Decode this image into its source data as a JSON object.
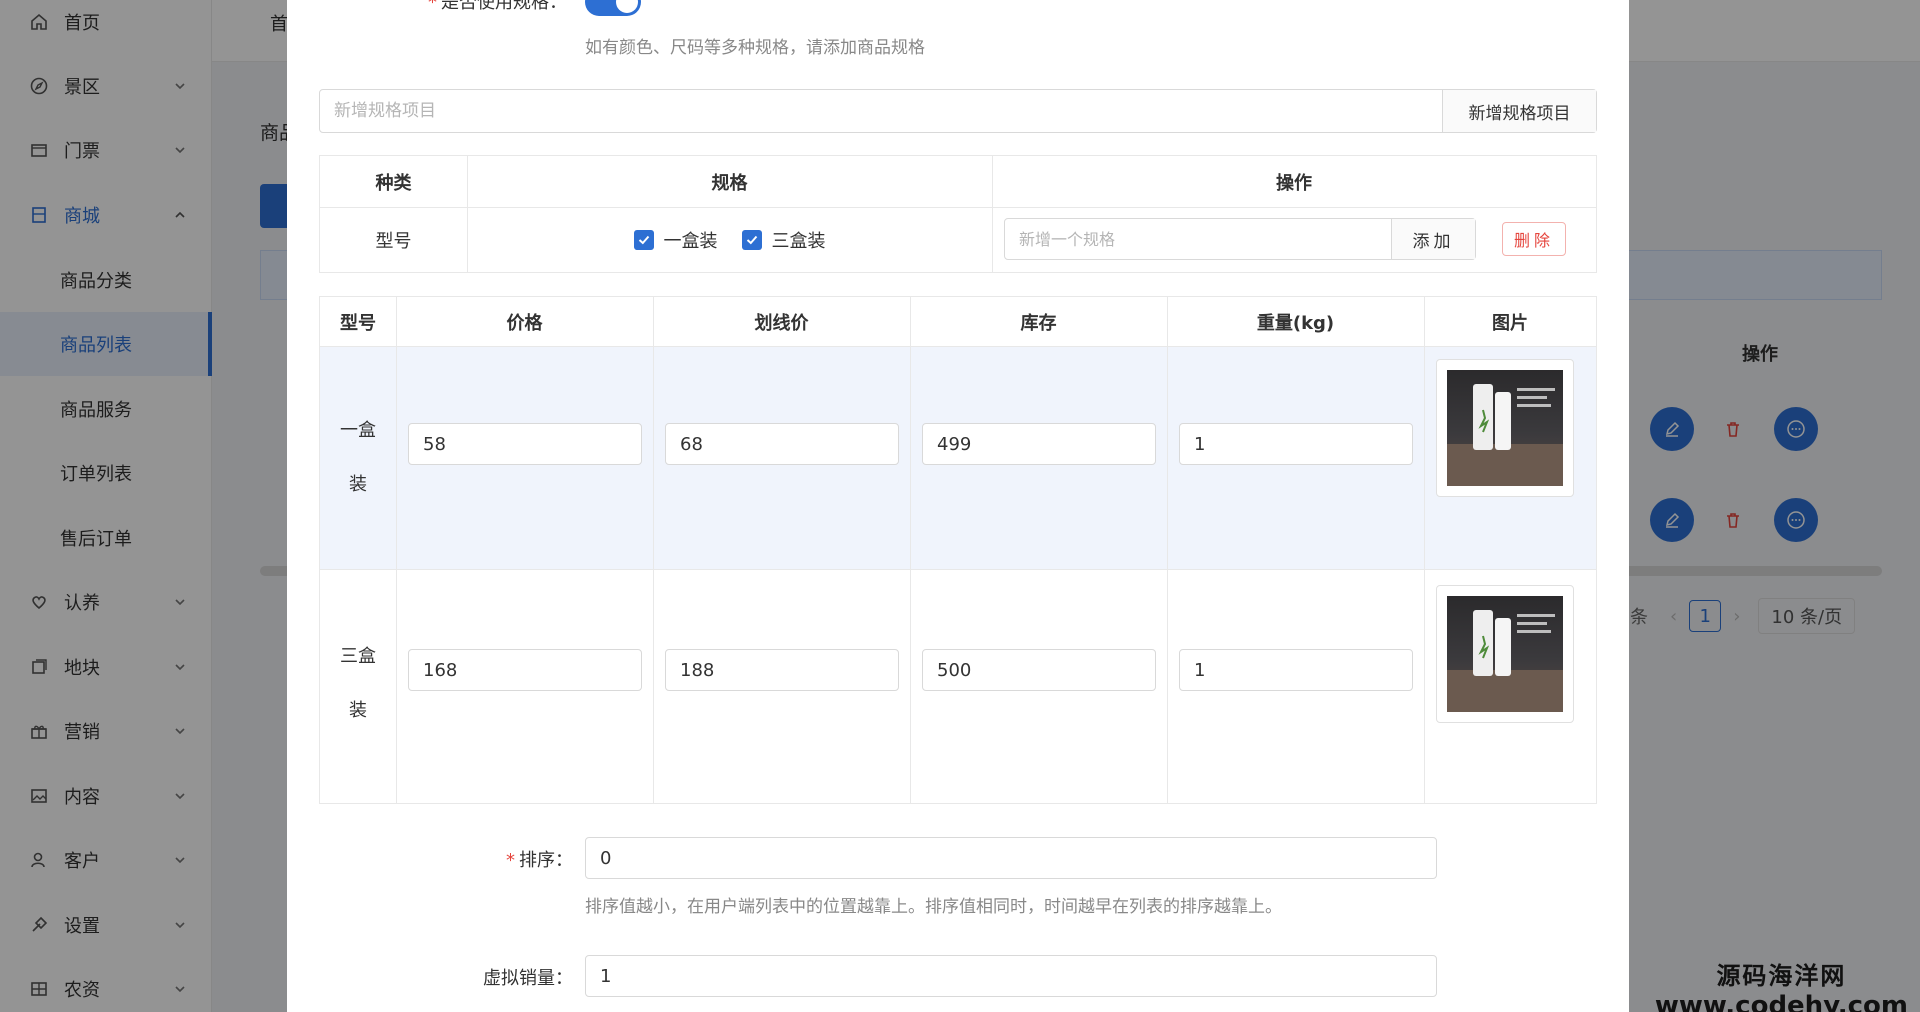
{
  "sidebar": {
    "items": [
      {
        "label": "首页",
        "icon": "home-icon"
      },
      {
        "label": "景区",
        "icon": "compass-icon"
      },
      {
        "label": "门票",
        "icon": "ticket-icon"
      },
      {
        "label": "商城",
        "icon": "shop-icon"
      },
      {
        "label": "商品分类"
      },
      {
        "label": "商品列表"
      },
      {
        "label": "商品服务"
      },
      {
        "label": "订单列表"
      },
      {
        "label": "售后订单"
      },
      {
        "label": "认养",
        "icon": "heart-icon"
      },
      {
        "label": "地块",
        "icon": "layers-icon"
      },
      {
        "label": "营销",
        "icon": "gift-icon"
      },
      {
        "label": "内容",
        "icon": "image-icon"
      },
      {
        "label": "客户",
        "icon": "user-icon"
      },
      {
        "label": "设置",
        "icon": "tool-icon"
      },
      {
        "label": "农资",
        "icon": "grid-icon"
      }
    ]
  },
  "topbar": {
    "crumb": "首"
  },
  "background": {
    "page_title": "商品",
    "ops_header": "操作",
    "pager": {
      "suffix": "条",
      "page": "1",
      "size": "10 条/页"
    }
  },
  "modal": {
    "use_spec_label": "是否使用规格",
    "use_spec_hint": "如有颜色、尺码等多种规格，请添加商品规格",
    "new_spec_item_placeholder": "新增规格项目",
    "new_spec_item_button": "新增规格项目",
    "cat_table": {
      "headers": [
        "种类",
        "规格",
        "操作"
      ],
      "row": {
        "kind": "型号",
        "options": [
          "一盒装",
          "三盒装"
        ]
      },
      "new_spec_placeholder": "新增一个规格",
      "add_button": "添加",
      "delete_button": "删除"
    },
    "var_table": {
      "headers": [
        "型号",
        "价格",
        "划线价",
        "库存",
        "重量(kg)",
        "图片"
      ],
      "rows": [
        {
          "label_line1": "一盒",
          "label_line2": "装",
          "price": "58",
          "list_price": "68",
          "stock": "499",
          "weight": "1"
        },
        {
          "label_line1": "三盒",
          "label_line2": "装",
          "price": "168",
          "list_price": "188",
          "stock": "500",
          "weight": "1"
        }
      ]
    },
    "sort_label": "排序",
    "sort_value": "0",
    "sort_hint": "排序值越小，在用户端列表中的位置越靠上。排序值相同时，时间越早在列表的排序越靠上。",
    "virtual_sales_label": "虚拟销量",
    "virtual_sales_value": "1"
  },
  "watermark": {
    "line1": "源码海洋网",
    "line2": "www.codehy.com"
  },
  "colors": {
    "accent": "#2d6fd3",
    "danger": "#e5443c"
  }
}
